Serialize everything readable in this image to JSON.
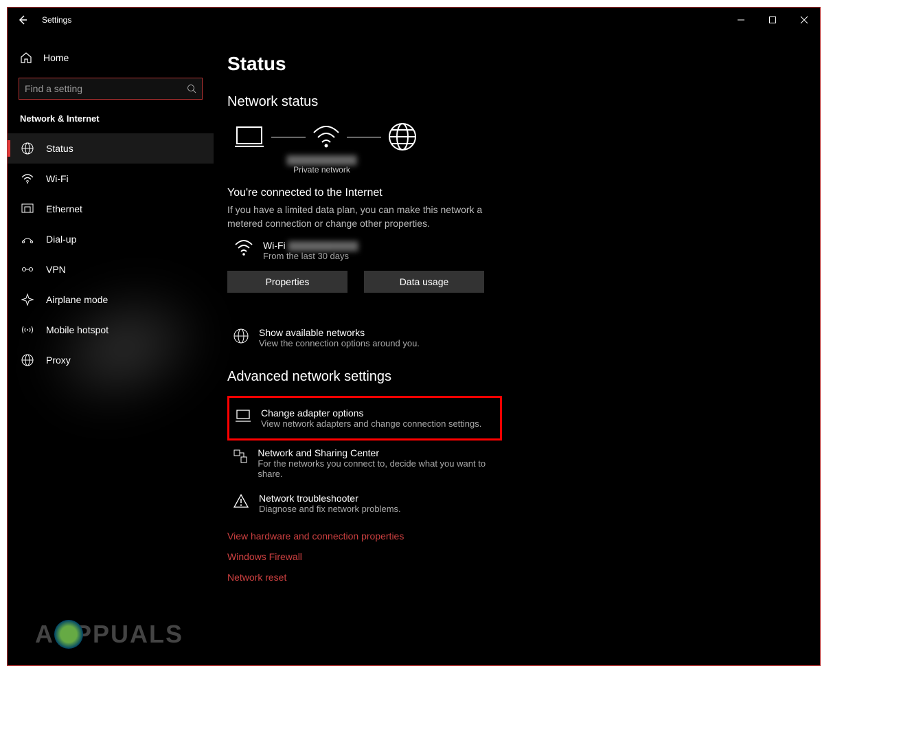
{
  "titlebar": {
    "title": "Settings"
  },
  "sidebar": {
    "home_label": "Home",
    "search_placeholder": "Find a setting",
    "category_label": "Network & Internet",
    "items": [
      {
        "label": "Status"
      },
      {
        "label": "Wi-Fi"
      },
      {
        "label": "Ethernet"
      },
      {
        "label": "Dial-up"
      },
      {
        "label": "VPN"
      },
      {
        "label": "Airplane mode"
      },
      {
        "label": "Mobile hotspot"
      },
      {
        "label": "Proxy"
      }
    ]
  },
  "content": {
    "page_title": "Status",
    "network_status_label": "Network status",
    "diagram": {
      "obscured_name": "████████████",
      "network_type": "Private network"
    },
    "conn_heading": "You're connected to the Internet",
    "conn_desc": "If you have a limited data plan, you can make this network a metered connection or change other properties.",
    "wifi_row": {
      "line1_prefix": "Wi-Fi ",
      "line1_blur": "████████████",
      "line2": "From the last 30 days"
    },
    "buttons": {
      "properties": "Properties",
      "data_usage": "Data usage"
    },
    "available_networks": {
      "title": "Show available networks",
      "desc": "View the connection options around you."
    },
    "advanced_label": "Advanced network settings",
    "options": [
      {
        "title": "Change adapter options",
        "desc": "View network adapters and change connection settings."
      },
      {
        "title": "Network and Sharing Center",
        "desc": "For the networks you connect to, decide what you want to share."
      },
      {
        "title": "Network troubleshooter",
        "desc": "Diagnose and fix network problems."
      }
    ],
    "links": [
      "View hardware and connection properties",
      "Windows Firewall",
      "Network reset"
    ]
  },
  "watermark": "PPUALS"
}
